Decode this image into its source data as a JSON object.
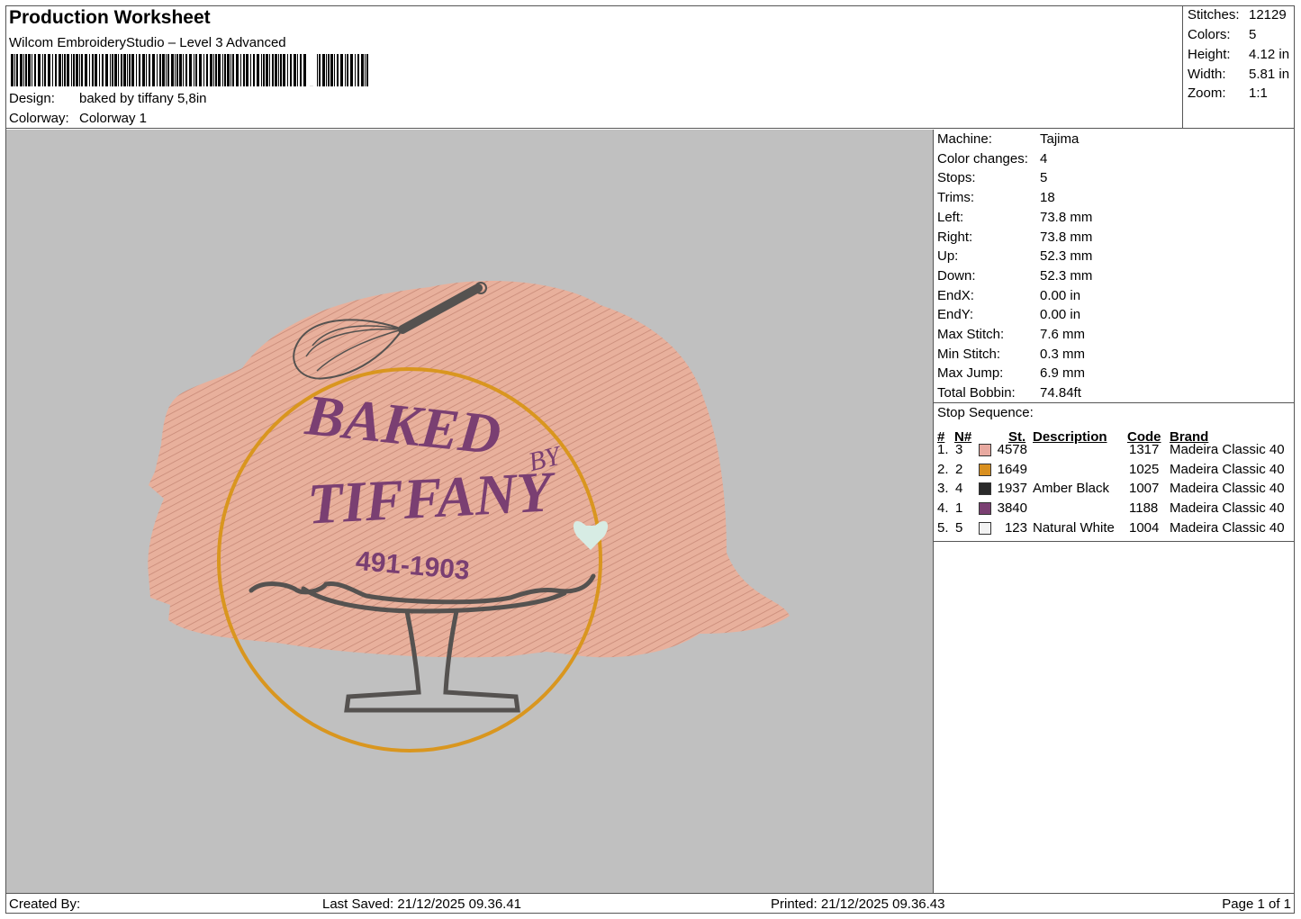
{
  "header": {
    "title": "Production Worksheet",
    "subtitle": "Wilcom EmbroideryStudio – Level 3 Advanced",
    "design_label": "Design:",
    "design_value": "baked by tiffany 5,8in",
    "colorway_label": "Colorway:",
    "colorway_value": "Colorway 1"
  },
  "stats": {
    "stitches_label": "Stitches:",
    "stitches_value": "12129",
    "colors_label": "Colors:",
    "colors_value": "5",
    "height_label": "Height:",
    "height_value": "4.12 in",
    "width_label": "Width:",
    "width_value": "5.81 in",
    "zoom_label": "Zoom:",
    "zoom_value": "1:1"
  },
  "machine_info": [
    {
      "label": "Machine:",
      "value": "Tajima"
    },
    {
      "label": "Color changes:",
      "value": "4"
    },
    {
      "label": "Stops:",
      "value": "5"
    },
    {
      "label": "Trims:",
      "value": "18"
    },
    {
      "label": "Left:",
      "value": "73.8 mm"
    },
    {
      "label": "Right:",
      "value": "73.8 mm"
    },
    {
      "label": "Up:",
      "value": "52.3 mm"
    },
    {
      "label": "Down:",
      "value": "52.3 mm"
    },
    {
      "label": "EndX:",
      "value": "0.00 in"
    },
    {
      "label": "EndY:",
      "value": "0.00 in"
    },
    {
      "label": "Max Stitch:",
      "value": "7.6 mm"
    },
    {
      "label": "Min Stitch:",
      "value": "0.3 mm"
    },
    {
      "label": "Max Jump:",
      "value": "6.9 mm"
    },
    {
      "label": "Total Bobbin:",
      "value": "74.84ft"
    }
  ],
  "stop_sequence": {
    "title": "Stop Sequence:",
    "columns": {
      "num": "#",
      "n": "N#",
      "st": "St.",
      "desc": "Description",
      "code": "Code",
      "brand": "Brand"
    },
    "rows": [
      {
        "num": "1.",
        "n": "3",
        "st": "4578",
        "desc": "",
        "code": "1317",
        "brand": "Madeira Classic 40",
        "color": "#e8a9a0"
      },
      {
        "num": "2.",
        "n": "2",
        "st": "1649",
        "desc": "",
        "code": "1025",
        "brand": "Madeira Classic 40",
        "color": "#d9901f"
      },
      {
        "num": "3.",
        "n": "4",
        "st": "1937",
        "desc": "Amber Black",
        "code": "1007",
        "brand": "Madeira Classic 40",
        "color": "#2a2a2a"
      },
      {
        "num": "4.",
        "n": "1",
        "st": "3840",
        "desc": "",
        "code": "1188",
        "brand": "Madeira Classic 40",
        "color": "#7a3f72"
      },
      {
        "num": "5.",
        "n": "5",
        "st": "123",
        "desc": "Natural White",
        "code": "1004",
        "brand": "Madeira Classic 40",
        "color": "#f2f2f2"
      }
    ]
  },
  "design": {
    "line1": "BAKED",
    "line2": "BY",
    "line3": "TIFFANY",
    "phone": "491-1903",
    "colors": {
      "canvas": "#c0c0c0",
      "blush": "#e8b09c",
      "gold": "#d9961f",
      "ink": "#555250",
      "plum": "#7a3f72",
      "mint": "#d7ece4"
    }
  },
  "footer": {
    "created": "Created By:",
    "saved": "Last Saved: 21/12/2025 09.36.41",
    "printed": "Printed: 21/12/2025 09.36.43",
    "page": "Page 1 of 1"
  }
}
